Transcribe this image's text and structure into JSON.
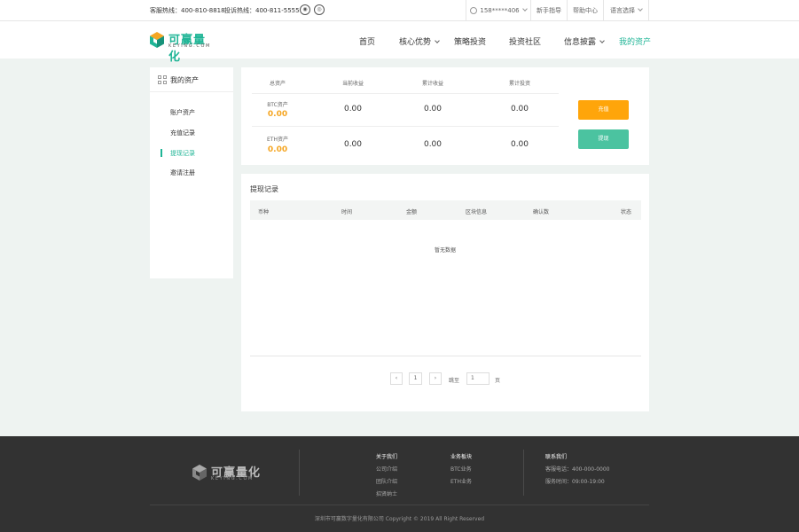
{
  "topbar": {
    "service_hotline": "客服热线：400-810-8818",
    "complaint_hotline": "投诉热线：400-811-5555",
    "user_phone": "158*****406",
    "guide": "新手指导",
    "help": "帮助中心",
    "language": "语言选择"
  },
  "brand": {
    "name": "可赢量化",
    "sub": "KEYING.COM"
  },
  "nav": [
    "首页",
    "核心优势",
    "策略投资",
    "投资社区",
    "信息披露",
    "我的资产"
  ],
  "sidebar": {
    "title": "我的资产",
    "items": [
      "账户资产",
      "充值记录",
      "提现记录",
      "邀请注册"
    ]
  },
  "assets": {
    "columns": [
      "总资产",
      "当前收益",
      "累计收益",
      "累计投资"
    ],
    "rows": [
      {
        "coin": "BTC资产",
        "total": "0.00",
        "current": "0.00",
        "cumulative": "0.00",
        "invested": "0.00"
      },
      {
        "coin": "ETH资产",
        "total": "0.00",
        "current": "0.00",
        "cumulative": "0.00",
        "invested": "0.00"
      }
    ],
    "deposit_label": "充值",
    "withdraw_label": "提现",
    "colors": {
      "deposit": "#ffa50a",
      "withdraw": "#4bc3a0",
      "accent": "#1fb596"
    }
  },
  "records": {
    "title": "提现记录",
    "columns": [
      "币种",
      "时间",
      "金额",
      "区块信息",
      "确认数",
      "状态"
    ],
    "empty": "暂无数据",
    "pagination": {
      "current_page": "1",
      "goto_label": "跳至",
      "goto_value": "1",
      "page_unit": "页"
    }
  },
  "footer": {
    "about": {
      "title": "关于我们",
      "links": [
        "公司介绍",
        "团队介绍",
        "招贤纳士"
      ]
    },
    "business": {
      "title": "业务板块",
      "links": [
        "BTC业务",
        "ETH业务"
      ]
    },
    "contact": {
      "title": "联系我们",
      "phone": "客服电话：400-000-0000",
      "hours": "服务时间：09:00-19:00"
    },
    "copyright": "深圳市可赢数字量化有限公司 Copyright © 2019 All Right Reserved"
  }
}
